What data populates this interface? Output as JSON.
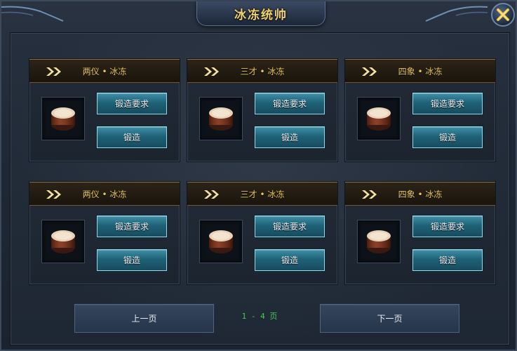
{
  "window": {
    "title": "冰冻统帅",
    "close_icon": "close-icon"
  },
  "items": [
    {
      "name": "两仪 • 冰冻",
      "req_label": "锻造要求",
      "forge_label": "锻造",
      "icon": "drum-icon"
    },
    {
      "name": "三才 • 冰冻",
      "req_label": "锻造要求",
      "forge_label": "锻造",
      "icon": "drum-icon"
    },
    {
      "name": "四象 • 冰冻",
      "req_label": "锻造要求",
      "forge_label": "锻造",
      "icon": "drum-icon"
    },
    {
      "name": "两仪 • 冰冻",
      "req_label": "锻造要求",
      "forge_label": "锻造",
      "icon": "drum-icon"
    },
    {
      "name": "三才 • 冰冻",
      "req_label": "锻造要求",
      "forge_label": "锻造",
      "icon": "drum-icon"
    },
    {
      "name": "四象 • 冰冻",
      "req_label": "锻造要求",
      "forge_label": "锻造",
      "icon": "drum-icon"
    }
  ],
  "pagination": {
    "prev_label": "上一页",
    "next_label": "下一页",
    "indicator": "1 - 4 页"
  },
  "colors": {
    "title": "#f2d46a",
    "item_name": "#e9c75b",
    "button_teal": "#1f6278",
    "page_indicator": "#3ccf52"
  }
}
